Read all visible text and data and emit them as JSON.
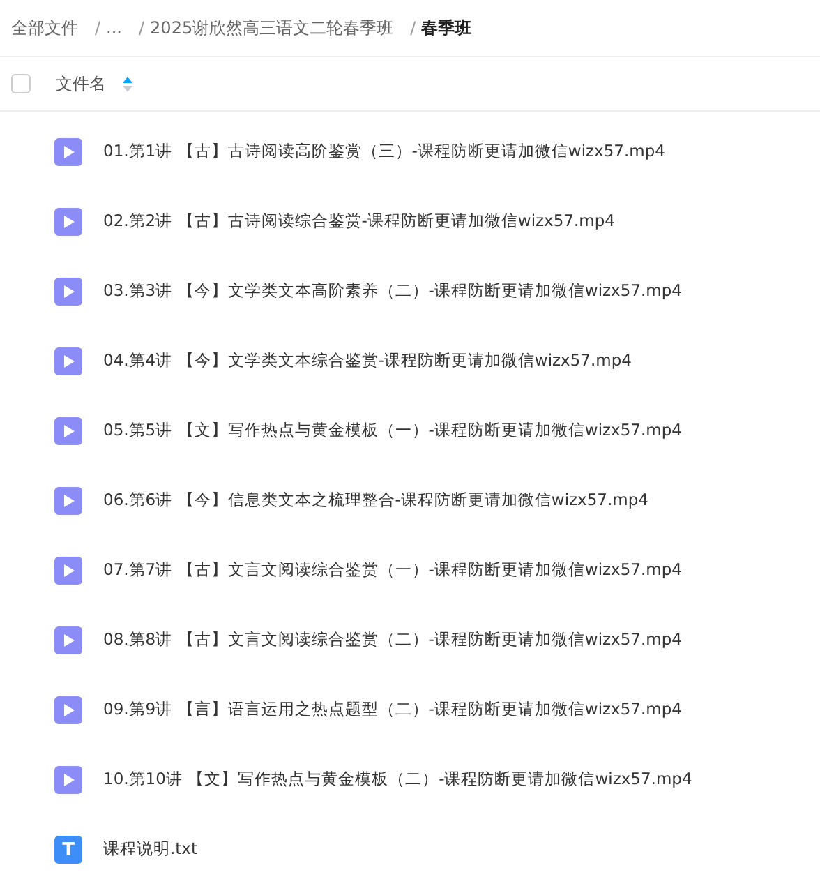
{
  "breadcrumb": [
    {
      "label": "全部文件",
      "current": false
    },
    {
      "separator": "/",
      "label": "...",
      "current": false
    },
    {
      "separator": "/",
      "label": "2025谢欣然高三语文二轮春季班",
      "current": false
    },
    {
      "separator": "/",
      "label": "春季班",
      "current": true
    }
  ],
  "table": {
    "select_all": {
      "checked": false
    },
    "column": {
      "label": "文件名",
      "sorted_ascending": true
    },
    "rows": [
      {
        "kind": "video",
        "name": "01.第1讲 【古】古诗阅读高阶鉴赏（三）-课程防断更请加微信wizx57.mp4"
      },
      {
        "kind": "video",
        "name": "02.第2讲 【古】古诗阅读综合鉴赏-课程防断更请加微信wizx57.mp4"
      },
      {
        "kind": "video",
        "name": "03.第3讲 【今】文学类文本高阶素养（二）-课程防断更请加微信wizx57.mp4"
      },
      {
        "kind": "video",
        "name": "04.第4讲 【今】文学类文本综合鉴赏-课程防断更请加微信wizx57.mp4"
      },
      {
        "kind": "video",
        "name": "05.第5讲 【文】写作热点与黄金模板（一）-课程防断更请加微信wizx57.mp4"
      },
      {
        "kind": "video",
        "name": "06.第6讲 【今】信息类文本之梳理整合-课程防断更请加微信wizx57.mp4"
      },
      {
        "kind": "video",
        "name": "07.第7讲 【古】文言文阅读综合鉴赏（一）-课程防断更请加微信wizx57.mp4"
      },
      {
        "kind": "video",
        "name": "08.第8讲 【古】文言文阅读综合鉴赏（二）-课程防断更请加微信wizx57.mp4"
      },
      {
        "kind": "video",
        "name": "09.第9讲 【言】语言运用之热点题型（二）-课程防断更请加微信wizx57.mp4"
      },
      {
        "kind": "video",
        "name": "10.第10讲 【文】写作热点与黄金模板（二）-课程防断更请加微信wizx57.mp4"
      },
      {
        "kind": "text",
        "name": "课程说明.txt",
        "icon_text": "T"
      }
    ]
  }
}
